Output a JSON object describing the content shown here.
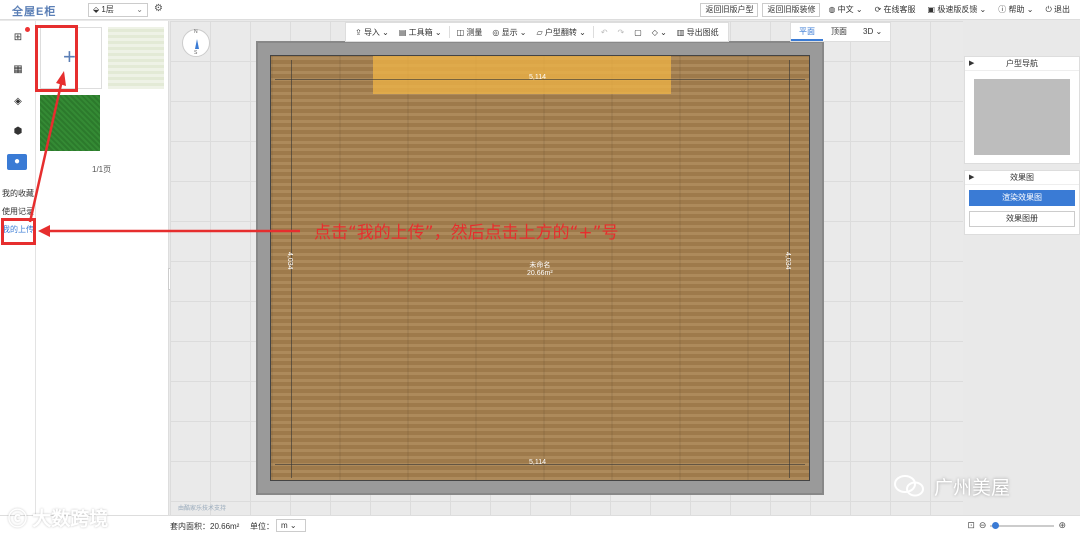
{
  "app": {
    "logo": "全屋E柜"
  },
  "topbar": {
    "floor_select": "1层",
    "gear_icon": "gear-icon",
    "buttons": [
      {
        "label": "返回旧版户型"
      },
      {
        "label": "返回旧版装修"
      }
    ],
    "links": [
      {
        "label": "中文"
      },
      {
        "label": "在线客服"
      },
      {
        "label": "极速版反馈"
      },
      {
        "label": "帮助"
      },
      {
        "label": "退出"
      }
    ]
  },
  "side_menu": {
    "icons": [
      "layout-icon",
      "grid-icon",
      "cube-icon",
      "hexagon-icon",
      "user-icon"
    ],
    "links": [
      {
        "label": "我的收藏"
      },
      {
        "label": "使用记录"
      },
      {
        "label": "我的上传"
      }
    ]
  },
  "left_panel": {
    "upload_plus": "+",
    "pager": "1/1页"
  },
  "toolbar": {
    "items": [
      {
        "label": "导入"
      },
      {
        "label": "工具箱"
      },
      {
        "label": "测量"
      },
      {
        "label": "显示"
      },
      {
        "label": "户型翻转"
      },
      {
        "label": "导出图纸"
      }
    ],
    "view_tabs": [
      {
        "label": "平面"
      },
      {
        "label": "顶面"
      },
      {
        "label": "3D"
      }
    ]
  },
  "canvas": {
    "compass": {
      "n": "N",
      "s": "S"
    },
    "dims": {
      "top": "5,114",
      "bottom": "5,114",
      "left": "4,034",
      "right": "4,034"
    },
    "room_label": {
      "name": "未命名",
      "area": "20.66m²"
    },
    "watermark": "由酷家乐技术支持"
  },
  "annotation": {
    "text": "点击“我的上传”，然后点击上方的“+”号",
    "color": "#e62e2e"
  },
  "right_panel": {
    "nav_title": "户型导航",
    "render_title": "效果图",
    "render_button": "渲染效果图",
    "album_button": "效果图册"
  },
  "bottombar": {
    "area": "套内面积：20.66m²",
    "unit_label": "单位：",
    "unit_value": "m"
  },
  "watermarks": {
    "left": "大数跨境",
    "right": "广州美屋"
  },
  "colors": {
    "accent": "#3a7bd5",
    "annotation_red": "#e62e2e",
    "floor": "#a7814f"
  }
}
